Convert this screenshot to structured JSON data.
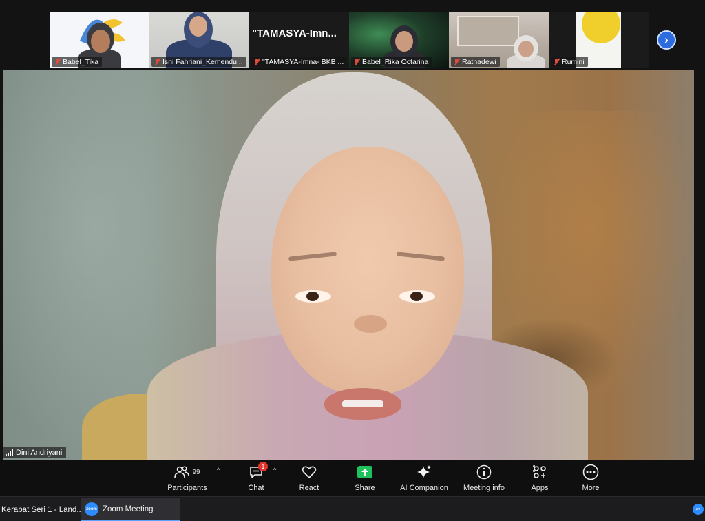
{
  "thumbnails": [
    {
      "name": "Babel_Tika",
      "mic_muted": true
    },
    {
      "name": "Isni Fahriani_Kemendu...",
      "mic_muted": true
    },
    {
      "name": "\"TAMASYA-Imna- BKB ...",
      "mic_muted": true,
      "big_label": "\"TAMASYA-Imn..."
    },
    {
      "name": "Babel_Rika Octarina",
      "mic_muted": true
    },
    {
      "name": "Ratnadewi",
      "mic_muted": true
    },
    {
      "name": "Rumini",
      "mic_muted": true
    }
  ],
  "main_speaker": {
    "name": "Dini Andriyani"
  },
  "toolbar": {
    "participants": {
      "label": "Participants",
      "count": "99"
    },
    "chat": {
      "label": "Chat",
      "badge": "1"
    },
    "react": {
      "label": "React"
    },
    "share": {
      "label": "Share"
    },
    "ai_companion": {
      "label": "AI Companion"
    },
    "meeting_info": {
      "label": "Meeting info"
    },
    "apps": {
      "label": "Apps"
    },
    "more": {
      "label": "More"
    }
  },
  "taskbar": {
    "item1": "Kerabat Seri 1 - Land...",
    "zoom_logo_text": "zoom",
    "item2": "Zoom Meeting",
    "tray_text": "zm"
  },
  "colors": {
    "share_green": "#1ec15c",
    "next_blue": "#2d6cdf",
    "muted_red": "#e14b3b"
  }
}
